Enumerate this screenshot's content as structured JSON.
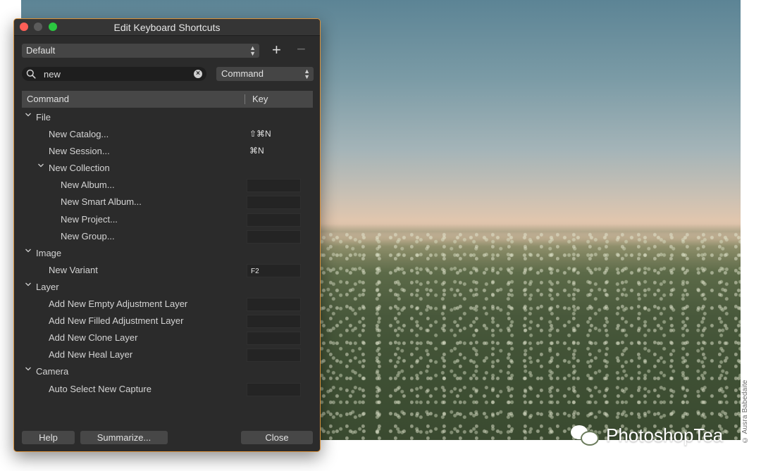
{
  "window": {
    "title": "Edit Keyboard Shortcuts"
  },
  "preset": {
    "value": "Default"
  },
  "search": {
    "value": "new"
  },
  "scope": {
    "value": "Command"
  },
  "table": {
    "col_command": "Command",
    "col_key": "Key"
  },
  "rows": [
    {
      "label": "File",
      "group": true
    },
    {
      "label": "New Catalog...",
      "key": "⇧⌘N"
    },
    {
      "label": "New Session...",
      "key": "⌘N"
    },
    {
      "label": "New Collection",
      "group": true
    },
    {
      "label": "New Album...",
      "key": ""
    },
    {
      "label": "New Smart Album...",
      "key": ""
    },
    {
      "label": "New Project...",
      "key": ""
    },
    {
      "label": "New Group...",
      "key": ""
    },
    {
      "label": "Image",
      "group": true
    },
    {
      "label": "New Variant",
      "key": "F2"
    },
    {
      "label": "Layer",
      "group": true
    },
    {
      "label": "Add New Empty Adjustment Layer",
      "key": ""
    },
    {
      "label": "Add New Filled Adjustment Layer",
      "key": ""
    },
    {
      "label": "Add New Clone Layer",
      "key": ""
    },
    {
      "label": "Add New Heal Layer",
      "key": ""
    },
    {
      "label": "Camera",
      "group": true
    },
    {
      "label": "Auto Select New Capture",
      "key": ""
    }
  ],
  "footer": {
    "help": "Help",
    "summarize": "Summarize...",
    "close": "Close"
  },
  "photo": {
    "credit": "© Ausra Babedaite",
    "watermark": "PhotoshopTea"
  },
  "icons": {
    "search": "search-icon",
    "clear": "clear-icon",
    "expand": "chevron-down-icon",
    "add": "plus-icon",
    "remove": "minus-icon",
    "stepper": "updown-icon",
    "watermark": "wechat-icon"
  },
  "colors": {
    "dialog_bg": "#2b2b2b",
    "dialog_border": "#d9913a",
    "close_red": "#fe5f57",
    "zoom_green": "#2bc840"
  }
}
